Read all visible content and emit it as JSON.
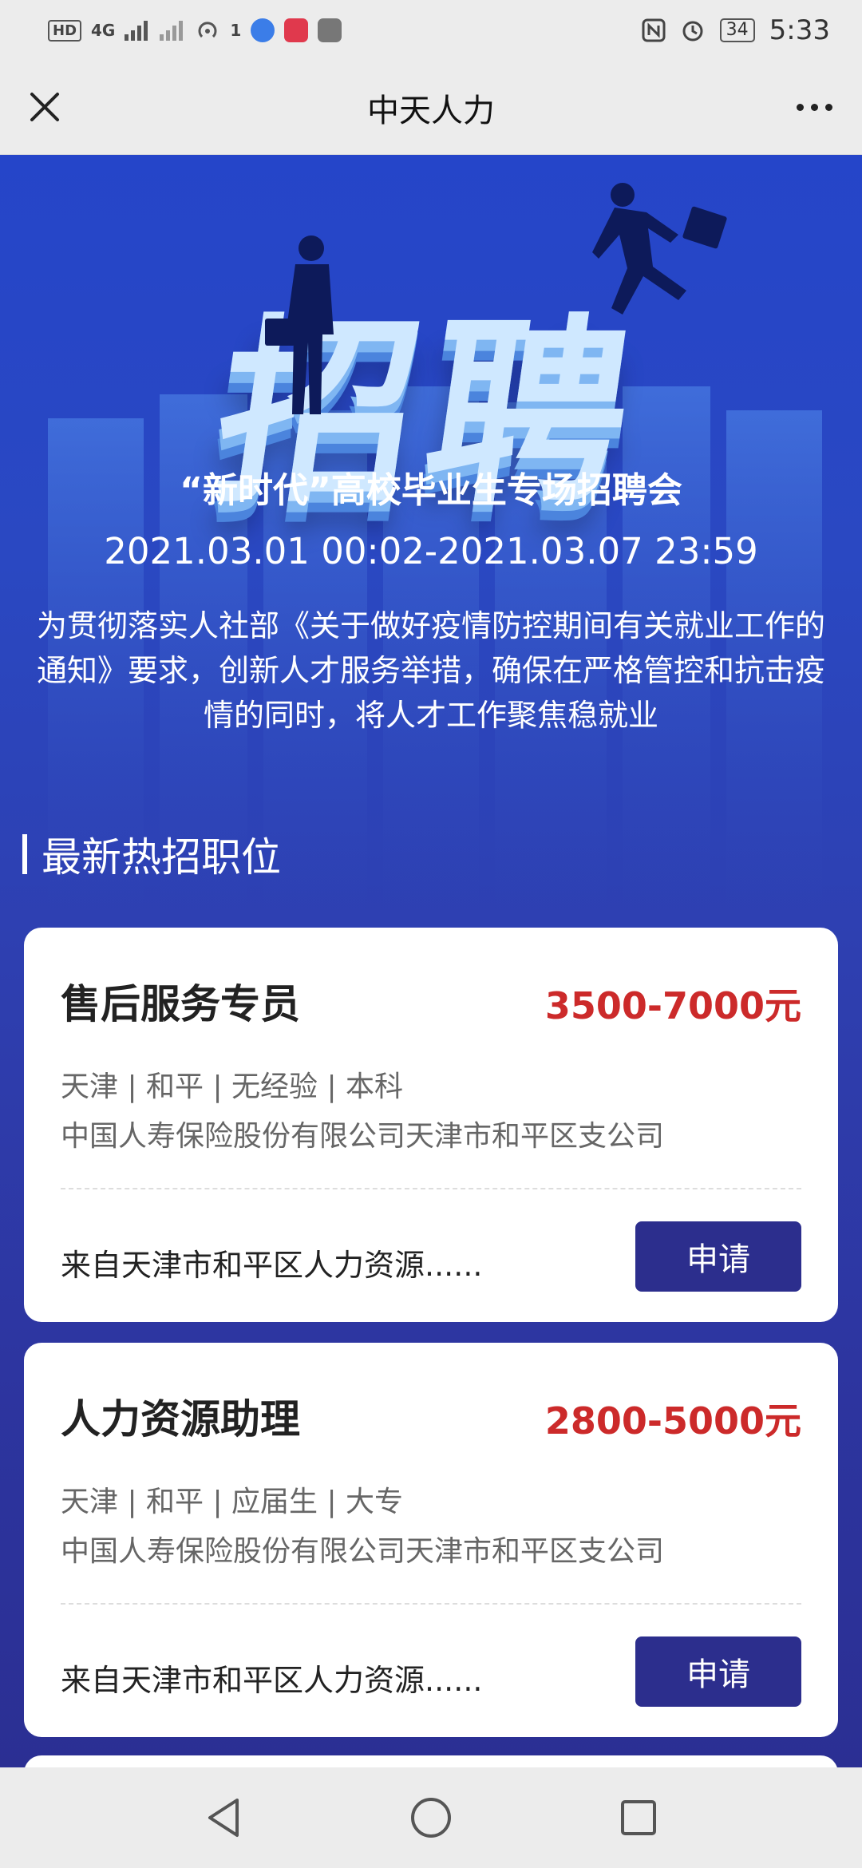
{
  "status_bar": {
    "left_items": [
      "HD",
      "4G",
      "46",
      "1"
    ],
    "battery": "34",
    "time": "5:33",
    "icons": [
      "hd-icon",
      "signal-icon",
      "signal-weak-icon",
      "hotspot-icon",
      "music-app-icon",
      "shopping-app-icon",
      "huawei-app-icon",
      "nfc-icon",
      "alarm-icon",
      "battery-icon"
    ]
  },
  "title_bar": {
    "title": "中天人力",
    "left_icon": "close-icon",
    "right_icon": "more-icon"
  },
  "hero": {
    "big_title": "招聘",
    "event_name": "“新时代”高校毕业生专场招聘会",
    "event_time": "2021.03.01 00:02-2021.03.07 23:59",
    "description": "为贯彻落实人社部《关于做好疫情防控期间有关就业工作的通知》要求，创新人才服务举措，确保在严格管控和抗击疫情的同时，将人才工作聚焦稳就业"
  },
  "section": {
    "title": "最新热招职位"
  },
  "jobs": [
    {
      "title": "售后服务专员",
      "salary": "3500-7000元",
      "tags": "天津 | 和平 | 无经验 | 本科",
      "company": "中国人寿保险股份有限公司天津市和平区支公司",
      "source": "来自天津市和平区人力资源......",
      "apply_label": "申请"
    },
    {
      "title": "人力资源助理",
      "salary": "2800-5000元",
      "tags": "天津 | 和平 | 应届生 | 大专",
      "company": "中国人寿保险股份有限公司天津市和平区支公司",
      "source": "来自天津市和平区人力资源......",
      "apply_label": "申请"
    }
  ],
  "nav_bar": {
    "icons": [
      "back-icon",
      "home-icon",
      "recents-icon"
    ]
  },
  "colors": {
    "accent": "#2c2e8d",
    "salary": "#cc2a2a",
    "background": "#2f3aa8"
  }
}
